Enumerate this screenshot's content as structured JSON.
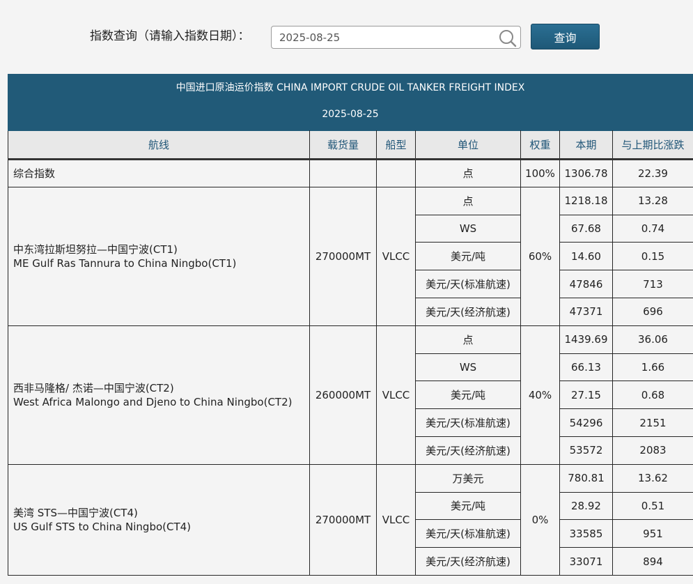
{
  "search": {
    "label": "指数查询（请输入指数日期）：",
    "value": "2025-08-25",
    "button_label": "查询"
  },
  "table": {
    "title": "中国进口原油运价指数 CHINA IMPORT CRUDE OIL TANKER FREIGHT INDEX",
    "date": "2025-08-25",
    "columns": [
      "航线",
      "载货量",
      "船型",
      "单位",
      "权重",
      "本期",
      "与上期比涨跌"
    ],
    "composite": {
      "route": "综合指数",
      "unit": "点",
      "weight": "100%",
      "current": "1306.78",
      "change": "22.39"
    },
    "groups": [
      {
        "route_cn": "中东湾拉斯坦努拉—中国宁波(CT1)",
        "route_en": "ME Gulf Ras Tannura to China Ningbo(CT1)",
        "cargo": "270000MT",
        "ship": "VLCC",
        "weight": "60%",
        "rows": [
          {
            "unit": "点",
            "current": "1218.18",
            "change": "13.28"
          },
          {
            "unit": "WS",
            "current": "67.68",
            "change": "0.74"
          },
          {
            "unit": "美元/吨",
            "current": "14.60",
            "change": "0.15"
          },
          {
            "unit": "美元/天(标准航速)",
            "current": "47846",
            "change": "713"
          },
          {
            "unit": "美元/天(经济航速)",
            "current": "47371",
            "change": "696"
          }
        ]
      },
      {
        "route_cn": "西非马隆格/ 杰诺—中国宁波(CT2)",
        "route_en": "West Africa Malongo and Djeno to China Ningbo(CT2)",
        "cargo": "260000MT",
        "ship": "VLCC",
        "weight": "40%",
        "rows": [
          {
            "unit": "点",
            "current": "1439.69",
            "change": "36.06"
          },
          {
            "unit": "WS",
            "current": "66.13",
            "change": "1.66"
          },
          {
            "unit": "美元/吨",
            "current": "27.15",
            "change": "0.68"
          },
          {
            "unit": "美元/天(标准航速)",
            "current": "54296",
            "change": "2151"
          },
          {
            "unit": "美元/天(经济航速)",
            "current": "53572",
            "change": "2083"
          }
        ]
      },
      {
        "route_cn": "美湾 STS—中国宁波(CT4)",
        "route_en": "US Gulf STS to China Ningbo(CT4)",
        "cargo": "270000MT",
        "ship": "VLCC",
        "weight": "0%",
        "rows": [
          {
            "unit": "万美元",
            "current": "780.81",
            "change": "13.62"
          },
          {
            "unit": "美元/吨",
            "current": "28.92",
            "change": "0.51"
          },
          {
            "unit": "美元/天(标准航速)",
            "current": "33585",
            "change": "951"
          },
          {
            "unit": "美元/天(经济航速)",
            "current": "33071",
            "change": "894"
          }
        ]
      }
    ]
  }
}
